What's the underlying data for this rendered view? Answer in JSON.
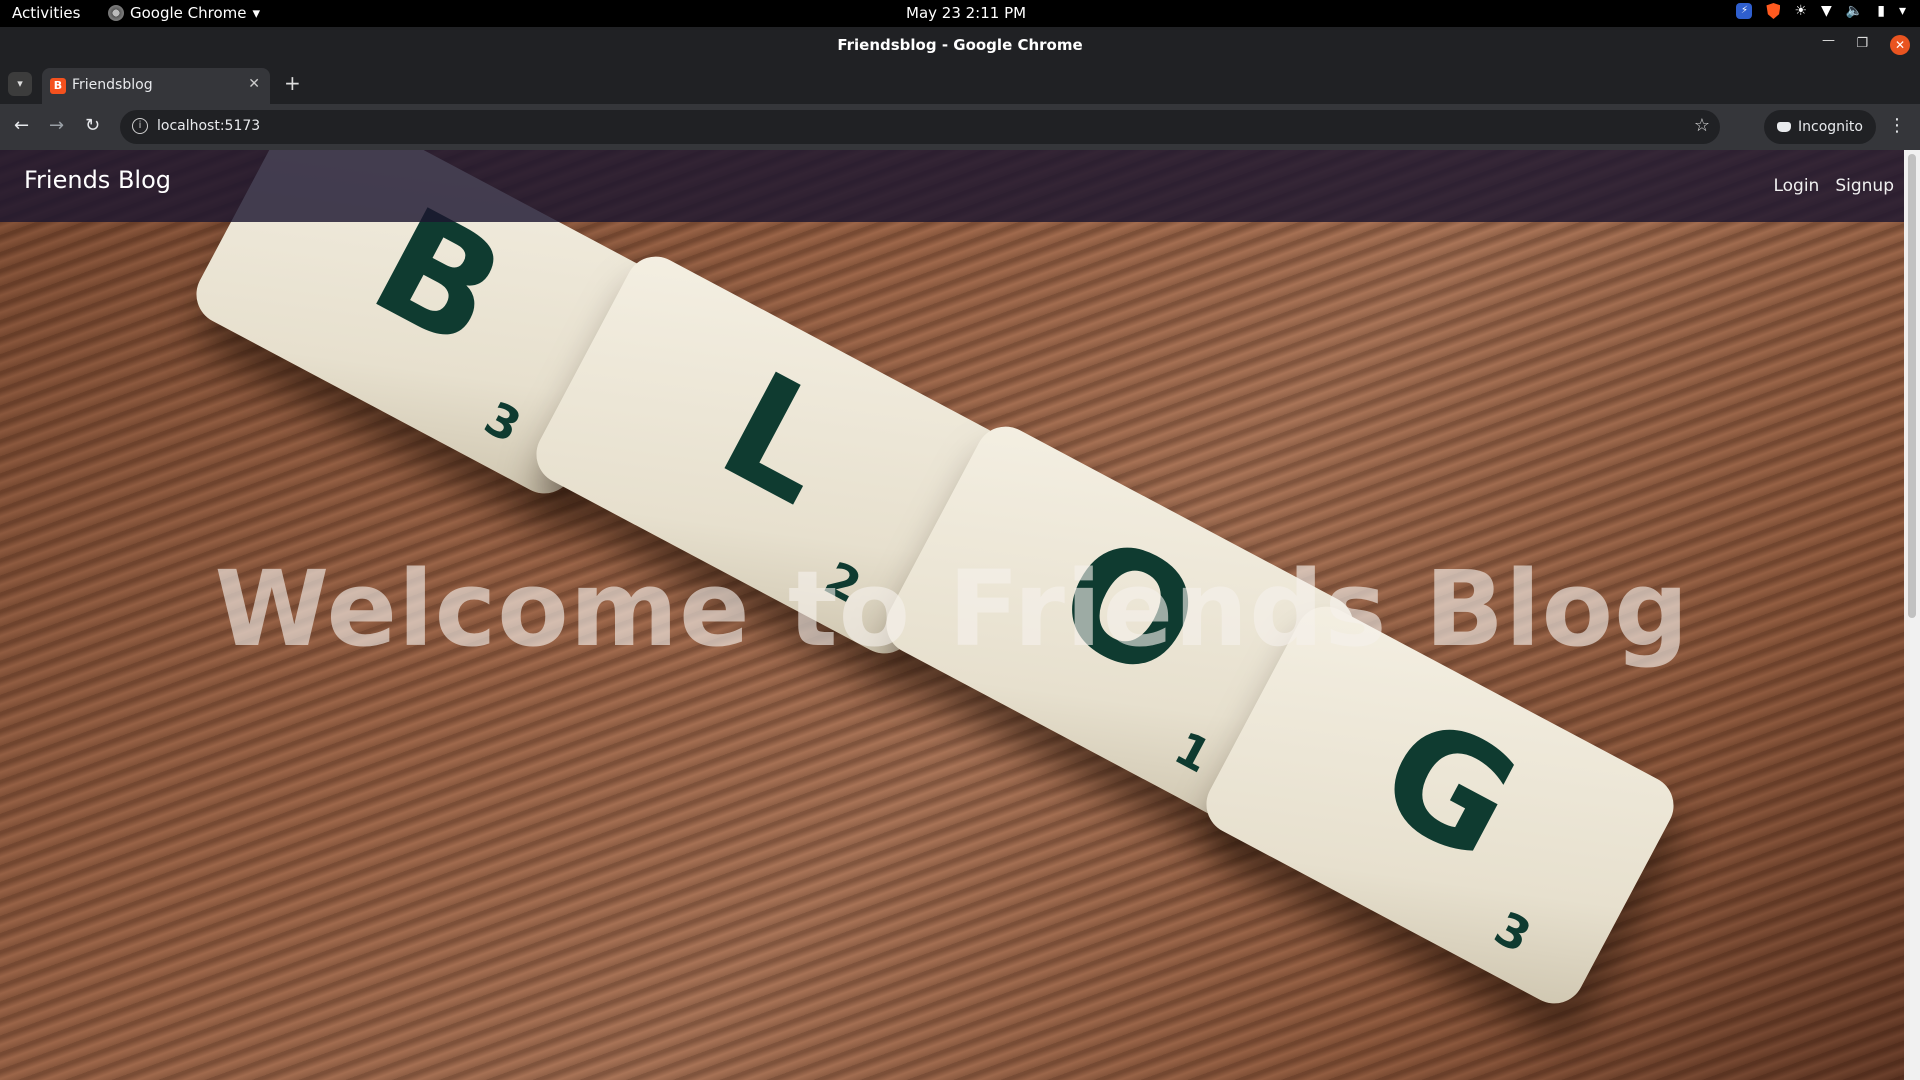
{
  "system_bar": {
    "activities": "Activities",
    "app_name": "Google Chrome",
    "clock": "May 23  2:11 PM"
  },
  "window": {
    "title": "Friendsblog - Google Chrome"
  },
  "tab": {
    "label": "Friendsblog",
    "favicon_letter": "B"
  },
  "toolbar": {
    "url": "localhost:5173",
    "incognito_label": "Incognito"
  },
  "site": {
    "brand": "Friends Blog",
    "nav": {
      "login": "Login",
      "signup": "Signup"
    },
    "hero_title": "Welcome to Friends Blog",
    "hero_tiles": [
      {
        "letter": "B",
        "score": "3"
      },
      {
        "letter": "L",
        "score": "2"
      },
      {
        "letter": "O",
        "score": "1"
      },
      {
        "letter": "G",
        "score": "3"
      }
    ]
  },
  "colors": {
    "nav_overlay": "#1c1630",
    "tile": "#f0eadb",
    "tile_ink": "#0f3b30",
    "wood": "#8b573c"
  }
}
